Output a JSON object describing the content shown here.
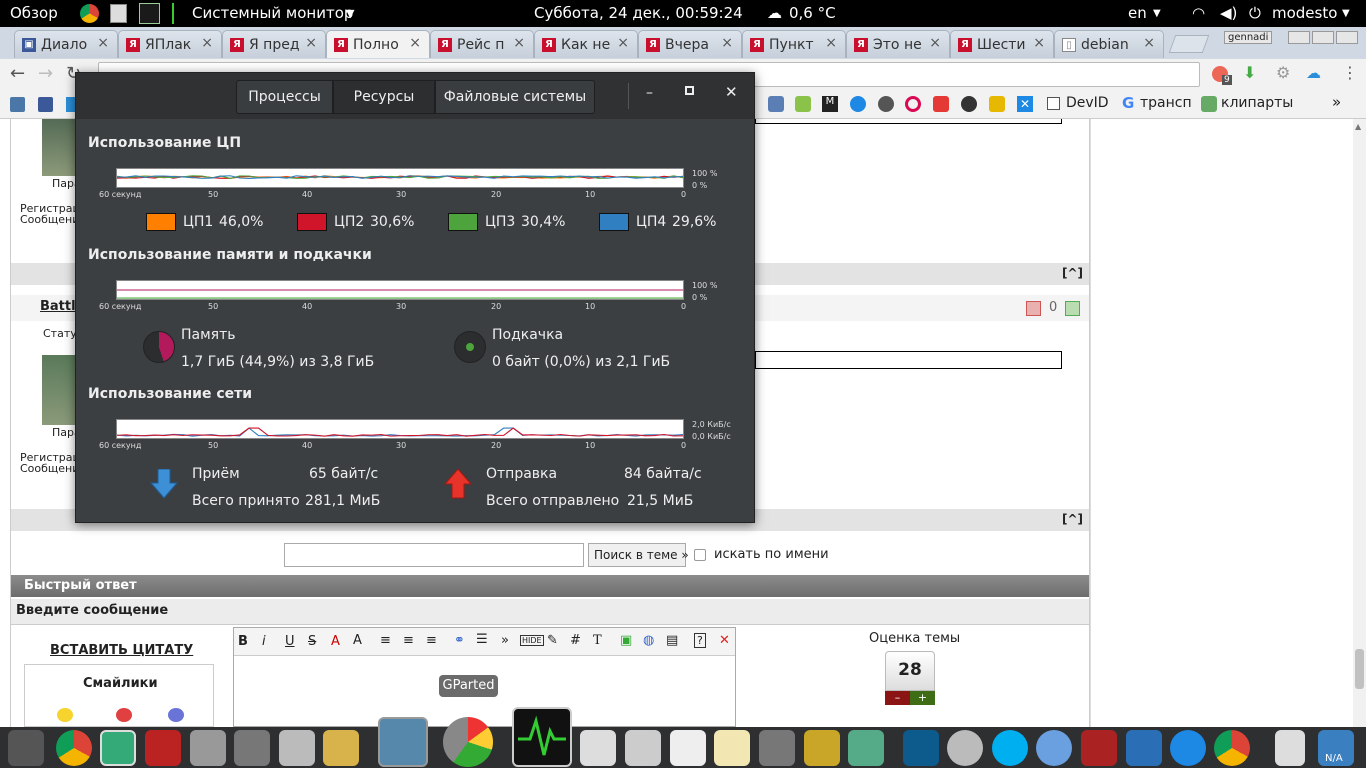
{
  "topbar": {
    "overview": "Обзор",
    "app_menu": "Системный монитор",
    "datetime": "Суббота, 24 дек., 00:59:24",
    "weather": "0,6 °C",
    "lang": "en",
    "user": "modesto"
  },
  "browser": {
    "tabs": [
      {
        "label": "Диало"
      },
      {
        "label": "ЯПлак"
      },
      {
        "label": "Я пред"
      },
      {
        "label": "Полно"
      },
      {
        "label": "Рейс п"
      },
      {
        "label": "Как не"
      },
      {
        "label": "Вчера"
      },
      {
        "label": "Пункт"
      },
      {
        "label": "Это не"
      },
      {
        "label": "Шести"
      },
      {
        "label": "debian"
      }
    ],
    "profile": "gennadi",
    "ext_badge": "9",
    "bookmarks": {
      "devid": "DevID",
      "transp": "трансп",
      "cliparts": "клипарты"
    }
  },
  "forum": {
    "post1_author_label": "Пара",
    "reg_label": "Регистрац",
    "msg_label": "Сообщени",
    "post2_author": "Battl",
    "status_label": "Статус",
    "karma": "0",
    "top_link": "[^]",
    "search_button": "Поиск в теме »",
    "search_by_name": "искать по имени",
    "quick_reply": "Быстрый ответ",
    "enter_message": "Введите сообщение",
    "insert_quote": "ВСТАВИТЬ ЦИТАТУ",
    "smileys": "Смайлики",
    "rating_title": "Оценка темы",
    "rating_value": "28",
    "rating_minus": "–",
    "rating_plus": "+"
  },
  "sysmon": {
    "tabs": [
      "Процессы",
      "Ресурсы",
      "Файловые системы"
    ],
    "active_tab": "Ресурсы",
    "cpu_title": "Использование ЦП",
    "mem_title": "Использование памяти и подкачки",
    "net_title": "Использование сети",
    "x_ticks": [
      "60 секунд",
      "50",
      "40",
      "30",
      "20",
      "10",
      "0"
    ],
    "cpu_y": [
      "100 %",
      "0 %"
    ],
    "mem_y": [
      "100 %",
      "0 %"
    ],
    "net_y": [
      "2,0 КиБ/с",
      "0,0 КиБ/с"
    ],
    "cpus": [
      {
        "label": "ЦП1",
        "value": "46,0%",
        "color": "#ff7f00"
      },
      {
        "label": "ЦП2",
        "value": "30,6%",
        "color": "#d0142a"
      },
      {
        "label": "ЦП3",
        "value": "30,4%",
        "color": "#4ea43c"
      },
      {
        "label": "ЦП4",
        "value": "29,6%",
        "color": "#2f7fc1"
      }
    ],
    "memory": {
      "label": "Память",
      "value": "1,7 ГиБ (44,9%) из 3,8 ГиБ",
      "color": "#b31a5c"
    },
    "swap": {
      "label": "Подкачка",
      "value": "0 байт (0,0%) из 2,1 ГиБ",
      "color": "#4ea43c"
    },
    "rx_label": "Приём",
    "rx_rate": "65 байт/с",
    "rx_total_label": "Всего принято",
    "rx_total": "281,1 МиБ",
    "tx_label": "Отправка",
    "tx_rate": "84 байта/с",
    "tx_total_label": "Всего отправлено",
    "tx_total": "21,5 МиБ"
  },
  "dock": {
    "tooltip": "GParted",
    "na_label": "N/A"
  }
}
